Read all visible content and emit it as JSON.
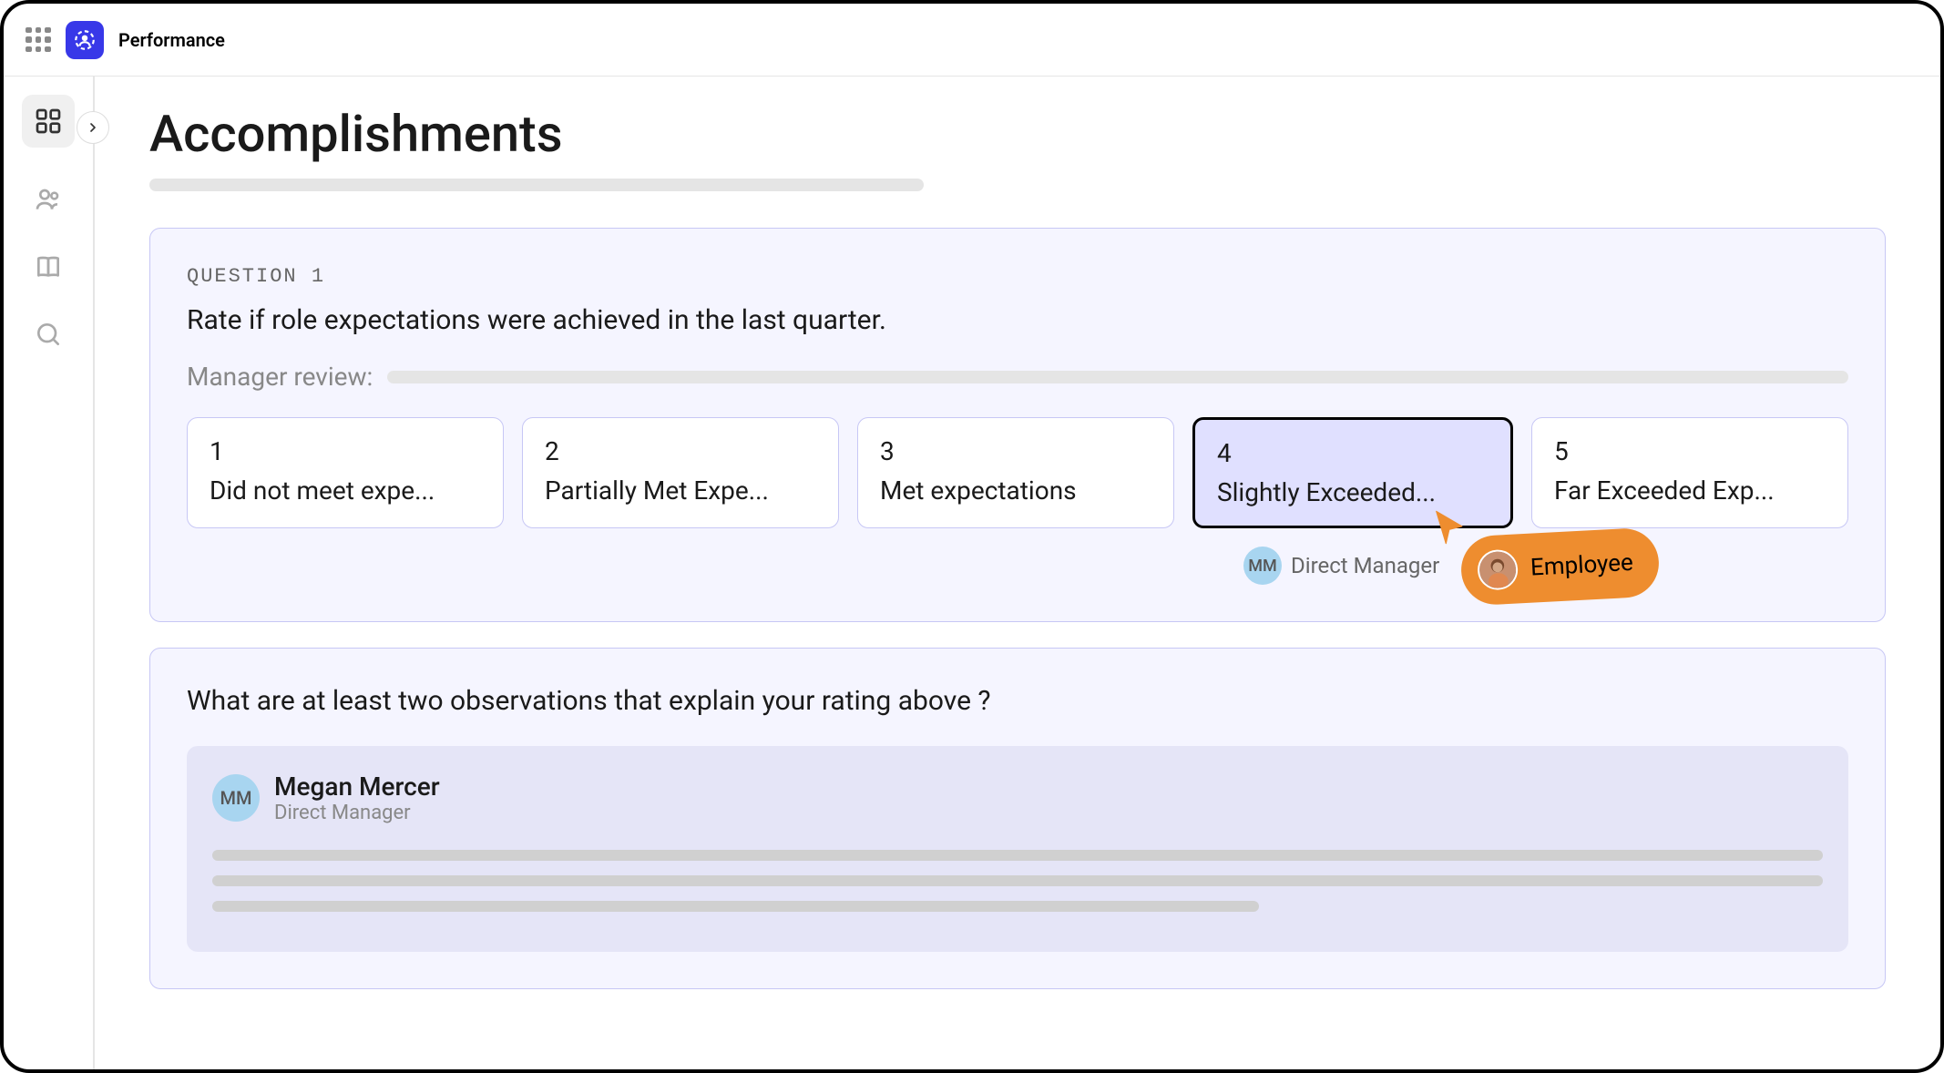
{
  "header": {
    "app_title": "Performance"
  },
  "page": {
    "title": "Accomplishments"
  },
  "question1": {
    "label": "QUESTION 1",
    "text": "Rate if role expectations were achieved in the last quarter.",
    "review_label": "Manager review:",
    "ratings": [
      {
        "number": "1",
        "text": "Did not meet expe..."
      },
      {
        "number": "2",
        "text": "Partially Met Expe..."
      },
      {
        "number": "3",
        "text": "Met expectations"
      },
      {
        "number": "4",
        "text": "Slightly Exceeded..."
      },
      {
        "number": "5",
        "text": "Far Exceeded Exp..."
      }
    ],
    "selected_index": 3,
    "manager": {
      "initials": "MM",
      "label": "Direct Manager"
    },
    "employee_cursor_label": "Employee"
  },
  "observation": {
    "question": "What are at least two observations that explain your rating above ?",
    "responder": {
      "initials": "MM",
      "name": "Megan Mercer",
      "role": "Direct Manager"
    }
  }
}
